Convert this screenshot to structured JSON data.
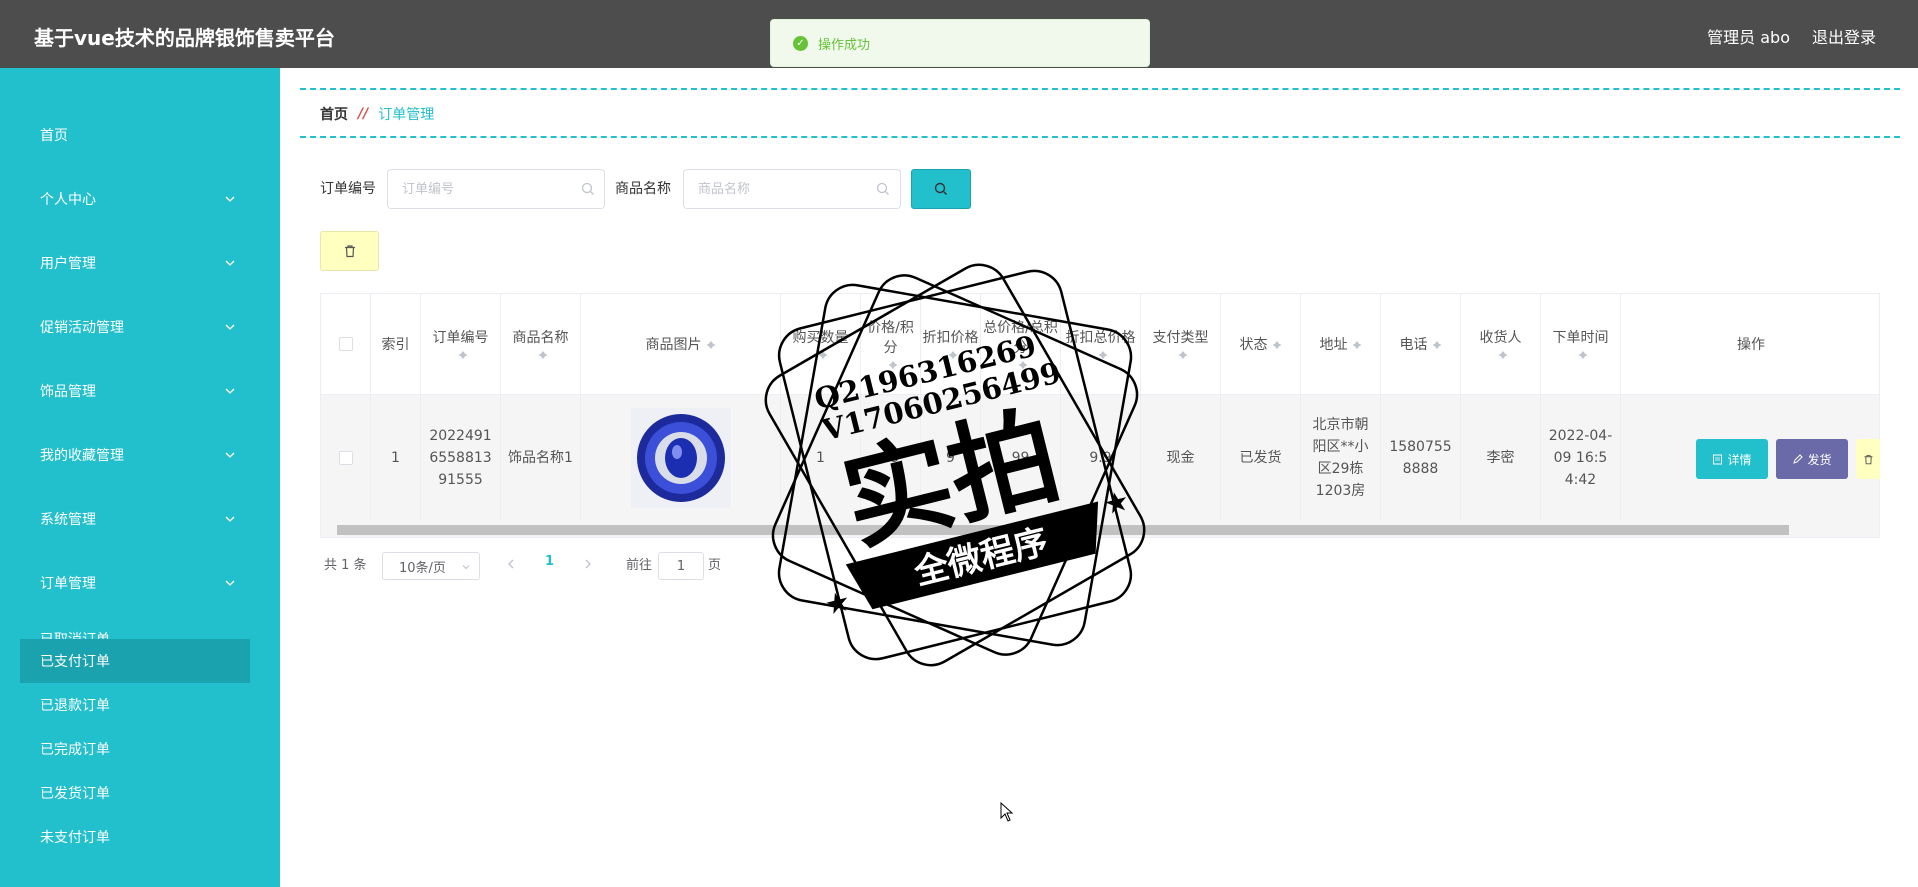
{
  "header": {
    "title": "基于vue技术的品牌银饰售卖平台",
    "user": "管理员 abo",
    "logout": "退出登录"
  },
  "toast": {
    "message": "操作成功"
  },
  "sidebar": {
    "items": [
      {
        "label": "首页"
      },
      {
        "label": "个人中心"
      },
      {
        "label": "用户管理"
      },
      {
        "label": "促销活动管理"
      },
      {
        "label": "饰品管理"
      },
      {
        "label": "我的收藏管理"
      },
      {
        "label": "系统管理"
      },
      {
        "label": "订单管理"
      }
    ],
    "sub_items": [
      {
        "label": "已取消订单"
      },
      {
        "label": "已支付订单"
      },
      {
        "label": "已退款订单"
      },
      {
        "label": "已完成订单"
      },
      {
        "label": "已发货订单"
      },
      {
        "label": "未支付订单"
      }
    ],
    "active_sub": "已支付订单"
  },
  "breadcrumb": {
    "home": "首页",
    "separator": "//",
    "current": "订单管理"
  },
  "search": {
    "order_no_label": "订单编号",
    "order_no_placeholder": "订单编号",
    "order_no_value": "",
    "product_label": "商品名称",
    "product_placeholder": "商品名称",
    "product_value": ""
  },
  "table": {
    "headers": [
      "索引",
      "订单编号",
      "商品名称",
      "商品图片",
      "购买数量",
      "价格/积分",
      "折扣价格",
      "总价格/总积分",
      "折扣总价格",
      "支付类型",
      "状态",
      "地址",
      "电话",
      "收货人",
      "下单时间",
      "操作"
    ],
    "rows": [
      {
        "index": "1",
        "order_no": "2022491655881391555",
        "product": "饰品名称1",
        "qty": "1",
        "price": "99",
        "discount_price": "9",
        "total": "99",
        "discount_total": "9.9",
        "pay_type": "现金",
        "status": "已发货",
        "address": "北京市朝阳区**小区29栋1203房",
        "phone": "15807558888",
        "receiver": "李密",
        "time": "2022-04-09 16:54:42"
      }
    ],
    "actions": {
      "detail": "详情",
      "ship": "发货"
    }
  },
  "pagination": {
    "total": "共 1 条",
    "page_size": "10条/页",
    "current_page": "1",
    "goto_label": "前往",
    "goto_value": "1",
    "goto_suffix": "页"
  },
  "watermark": {
    "qq": "Q2196316269",
    "vx": "V17060256499",
    "main": "实拍",
    "banner": "全微程序"
  },
  "colors": {
    "header_bg": "#4d4d4d",
    "sidebar_bg": "#22bfcd",
    "sidebar_active": "#1aa3ae",
    "accent": "#22bfcd",
    "ship_button": "#6a6aa8",
    "delete_button": "#ffffc0",
    "toast_success": "#67c23a"
  }
}
